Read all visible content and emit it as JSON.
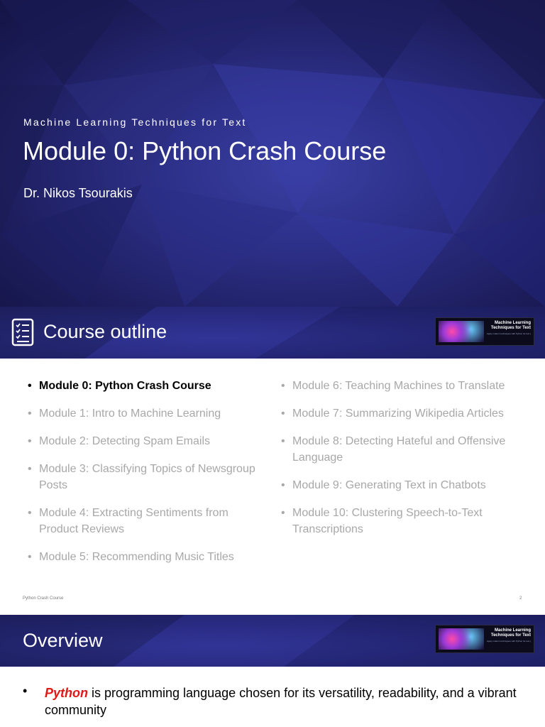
{
  "slide1": {
    "subtitle": "Machine Learning Techniques for Text",
    "title": "Module 0: Python Crash Course",
    "author": "Dr. Nikos Tsourakis"
  },
  "slide2": {
    "header_title": "Course outline",
    "header_icon": "checklist-icon",
    "thumbnail": {
      "title": "Machine Learning Techniques for Text",
      "caption": "Apply modern techniques with Python for text processing, dimensionality reduction, classification, and evaluation"
    },
    "left_column": [
      {
        "label": "Module 0: Python Crash Course",
        "active": true
      },
      {
        "label": "Module 1: Intro to Machine Learning",
        "active": false
      },
      {
        "label": "Module 2: Detecting Spam Emails",
        "active": false
      },
      {
        "label": "Module 3: Classifying Topics of Newsgroup Posts",
        "active": false
      },
      {
        "label": "Module 4: Extracting Sentiments from Product Reviews",
        "active": false
      },
      {
        "label": "Module 5: Recommending Music Titles",
        "active": false
      }
    ],
    "right_column": [
      {
        "label": "Module 6: Teaching Machines to Translate",
        "active": false
      },
      {
        "label": "Module 7: Summarizing Wikipedia Articles",
        "active": false
      },
      {
        "label": "Module 8: Detecting Hateful and Offensive Language",
        "active": false
      },
      {
        "label": "Module 9: Generating Text in Chatbots",
        "active": false
      },
      {
        "label": "Module 10: Clustering Speech-to-Text Transcriptions",
        "active": false
      }
    ],
    "footer_left": "Python Crash Course",
    "page_number": "2"
  },
  "slide3": {
    "header_title": "Overview",
    "thumbnail": {
      "title": "Machine Learning Techniques for Text",
      "caption": "Apply modern techniques with Python for text processing, dimensionality reduction, classification, and evaluation"
    },
    "bullet_emphasis": "Python",
    "bullet_rest": " is programming language chosen for its versatility, readability, and a vibrant community"
  },
  "colors": {
    "header_blue": "#262879",
    "inactive_text": "#a8a8a8",
    "active_text": "#000000",
    "emphasis_red": "#e01818"
  }
}
